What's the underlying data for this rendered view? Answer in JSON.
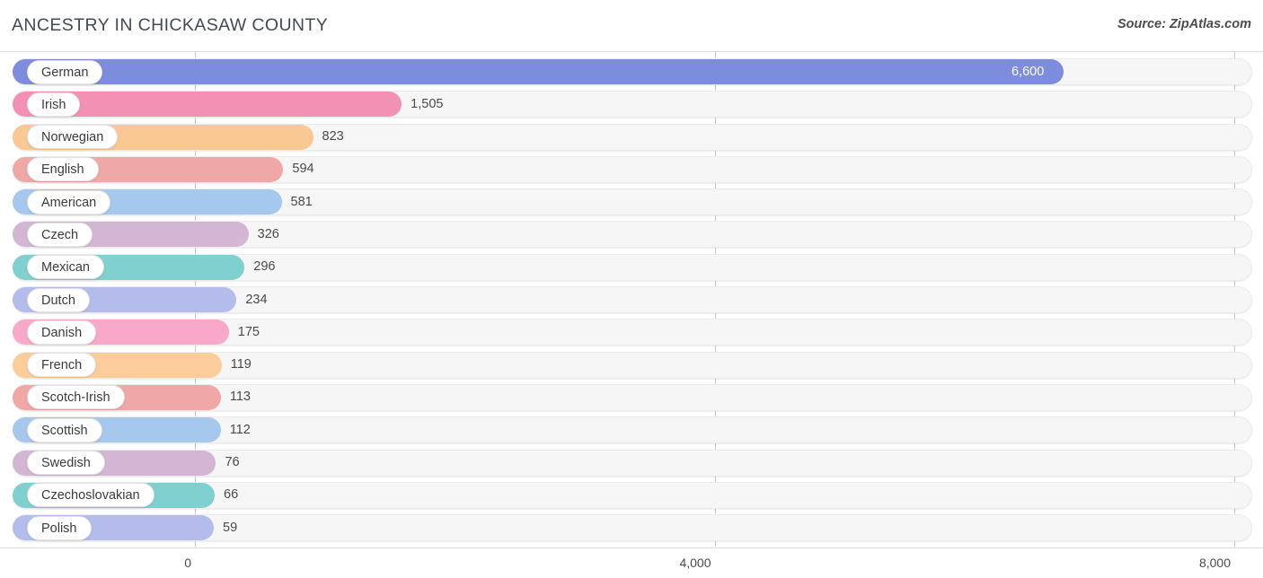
{
  "header": {
    "title": "ANCESTRY IN CHICKASAW COUNTY",
    "source": "Source: ZipAtlas.com"
  },
  "chart_data": {
    "type": "bar",
    "orientation": "horizontal",
    "title": "ANCESTRY IN CHICKASAW COUNTY",
    "subtitle": "",
    "xlabel": "",
    "ylabel": "",
    "xlim": [
      0,
      8000
    ],
    "grid": true,
    "legend": "none",
    "xticks": [
      0,
      4000,
      8000
    ],
    "xtick_labels": [
      "0",
      "4,000",
      "8,000"
    ],
    "categories": [
      "German",
      "Irish",
      "Norwegian",
      "English",
      "American",
      "Czech",
      "Mexican",
      "Dutch",
      "Danish",
      "French",
      "Scotch-Irish",
      "Scottish",
      "Swedish",
      "Czechoslovakian",
      "Polish"
    ],
    "values": [
      6600,
      1505,
      823,
      594,
      581,
      326,
      296,
      234,
      175,
      119,
      113,
      112,
      76,
      66,
      59
    ],
    "value_labels": [
      "6,600",
      "1,505",
      "823",
      "594",
      "581",
      "326",
      "296",
      "234",
      "175",
      "119",
      "113",
      "112",
      "76",
      "66",
      "59"
    ],
    "colors": [
      "#7e8cde",
      "#f391b5",
      "#f9c893",
      "#efa8a5",
      "#a6c8ec",
      "#d3b6d4",
      "#7fd0ce",
      "#b4bcec",
      "#f8a8c8",
      "#fbcd9b",
      "#efa8a5",
      "#a6c8ec",
      "#d3b6d4",
      "#7fd0ce",
      "#b4bcec"
    ],
    "label_inside": [
      true,
      false,
      false,
      false,
      false,
      false,
      false,
      false,
      false,
      false,
      false,
      false,
      false,
      false,
      false
    ]
  },
  "style": {
    "track_color": "#f6f6f6",
    "grid_color": "#c9c9c9",
    "text_color": "#4a4a4a",
    "title_color": "#434a54"
  }
}
